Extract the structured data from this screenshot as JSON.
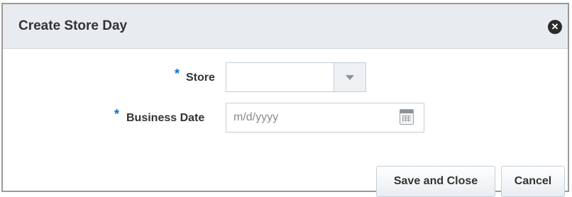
{
  "dialog": {
    "title": "Create Store Day",
    "close_icon": "close-circle-icon"
  },
  "form": {
    "required_marker": "*",
    "store": {
      "label": "Store",
      "value": "",
      "dropdown_icon": "chevron-down-icon"
    },
    "business_date": {
      "label": "Business Date",
      "placeholder": "m/d/yyyy",
      "value": "",
      "calendar_icon": "calendar-icon"
    }
  },
  "buttons": {
    "save_and_close": "Save and Close",
    "cancel": "Cancel"
  },
  "colors": {
    "header_bg": "#e8ebef",
    "required_marker": "#0572ce",
    "border": "#9a9a9a"
  }
}
